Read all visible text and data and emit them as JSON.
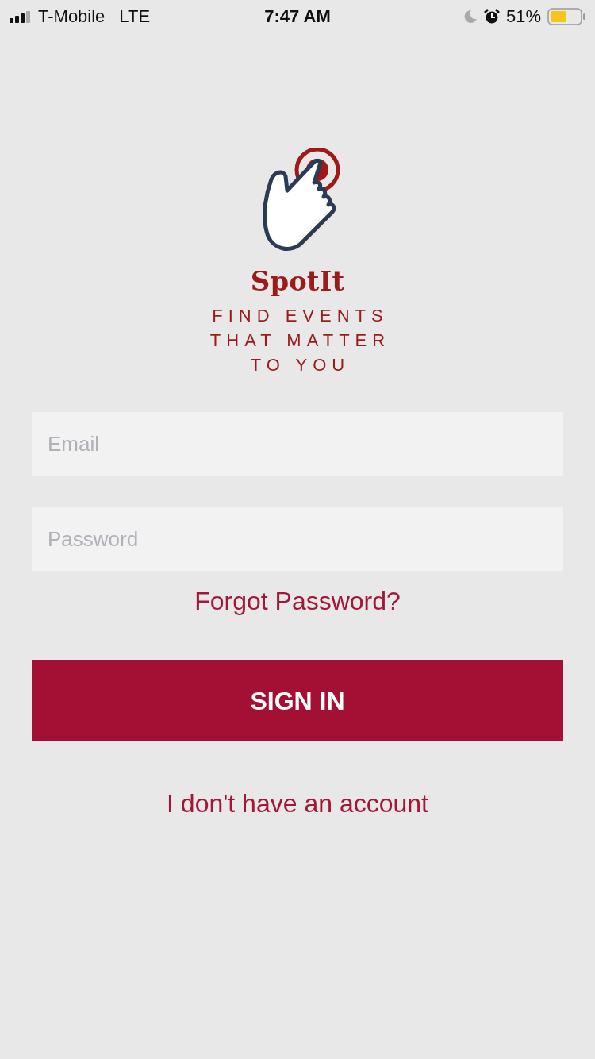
{
  "status_bar": {
    "carrier": "T-Mobile",
    "network": "LTE",
    "time": "7:47 AM",
    "battery": "51%"
  },
  "logo": {
    "name": "SpotIt",
    "tagline": [
      "FIND EVENTS",
      "THAT MATTER",
      "TO YOU"
    ]
  },
  "form": {
    "email": {
      "placeholder": "Email"
    },
    "password": {
      "placeholder": "Password"
    },
    "forgot_link": "Forgot Password?",
    "sign_in_button": "SIGN IN",
    "no_account_link": "I don't have an account"
  }
}
